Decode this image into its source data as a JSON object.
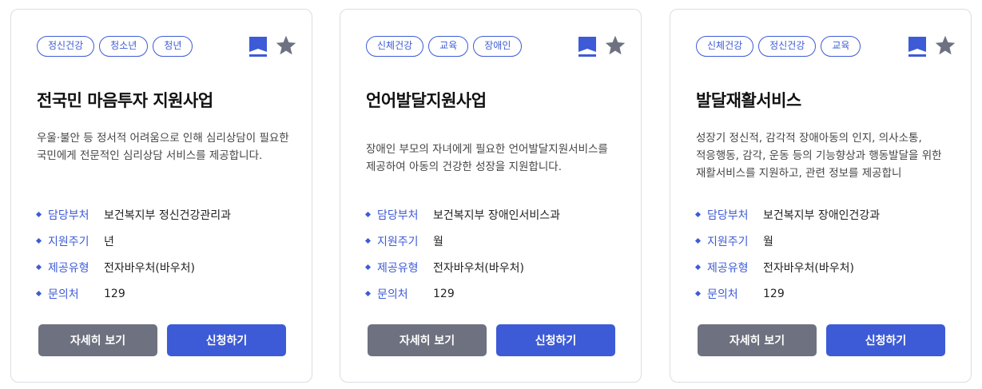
{
  "colors": {
    "accent": "#3d5bd6",
    "detail_button": "#6e717f",
    "star": "#6e717f",
    "border": "#dcdde2"
  },
  "icons": {
    "bookmark": "bookmark-icon",
    "star": "star-icon",
    "bullet": "diamond-bullet-icon"
  },
  "cards": [
    {
      "tags": [
        "정신건강",
        "청소년",
        "청년"
      ],
      "title": "전국민 마음투자 지원사업",
      "description": "우울·불안 등 정서적 어려움으로 인해 심리상담이 필요한 국민에게 전문적인 심리상담 서비스를 제공합니다.",
      "info": [
        {
          "label": "담당부처",
          "value": "보건복지부 정신건강관리과"
        },
        {
          "label": "지원주기",
          "value": "년"
        },
        {
          "label": "제공유형",
          "value": "전자바우처(바우처)"
        },
        {
          "label": "문의처",
          "value": "129"
        }
      ],
      "detail_label": "자세히 보기",
      "apply_label": "신청하기"
    },
    {
      "tags": [
        "신체건강",
        "교육",
        "장애인"
      ],
      "title": "언어발달지원사업",
      "description": "장애인 부모의 자녀에게 필요한 언어발달지원서비스를 제공하여 아동의 건강한 성장을 지원합니다.",
      "info": [
        {
          "label": "담당부처",
          "value": "보건복지부 장애인서비스과"
        },
        {
          "label": "지원주기",
          "value": "월"
        },
        {
          "label": "제공유형",
          "value": "전자바우처(바우처)"
        },
        {
          "label": "문의처",
          "value": "129"
        }
      ],
      "detail_label": "자세히 보기",
      "apply_label": "신청하기"
    },
    {
      "tags": [
        "신체건강",
        "정신건강",
        "교육"
      ],
      "title": "발달재활서비스",
      "description": "성장기 정신적, 감각적 장애아동의 인지, 의사소통, 적응행동, 감각, 운동 등의 기능향상과 행동발달을 위한 재활서비스를 지원하고, 관련 정보를 제공합니",
      "info": [
        {
          "label": "담당부처",
          "value": "보건복지부 장애인건강과"
        },
        {
          "label": "지원주기",
          "value": "월"
        },
        {
          "label": "제공유형",
          "value": "전자바우처(바우처)"
        },
        {
          "label": "문의처",
          "value": "129"
        }
      ],
      "detail_label": "자세히 보기",
      "apply_label": "신청하기"
    }
  ]
}
